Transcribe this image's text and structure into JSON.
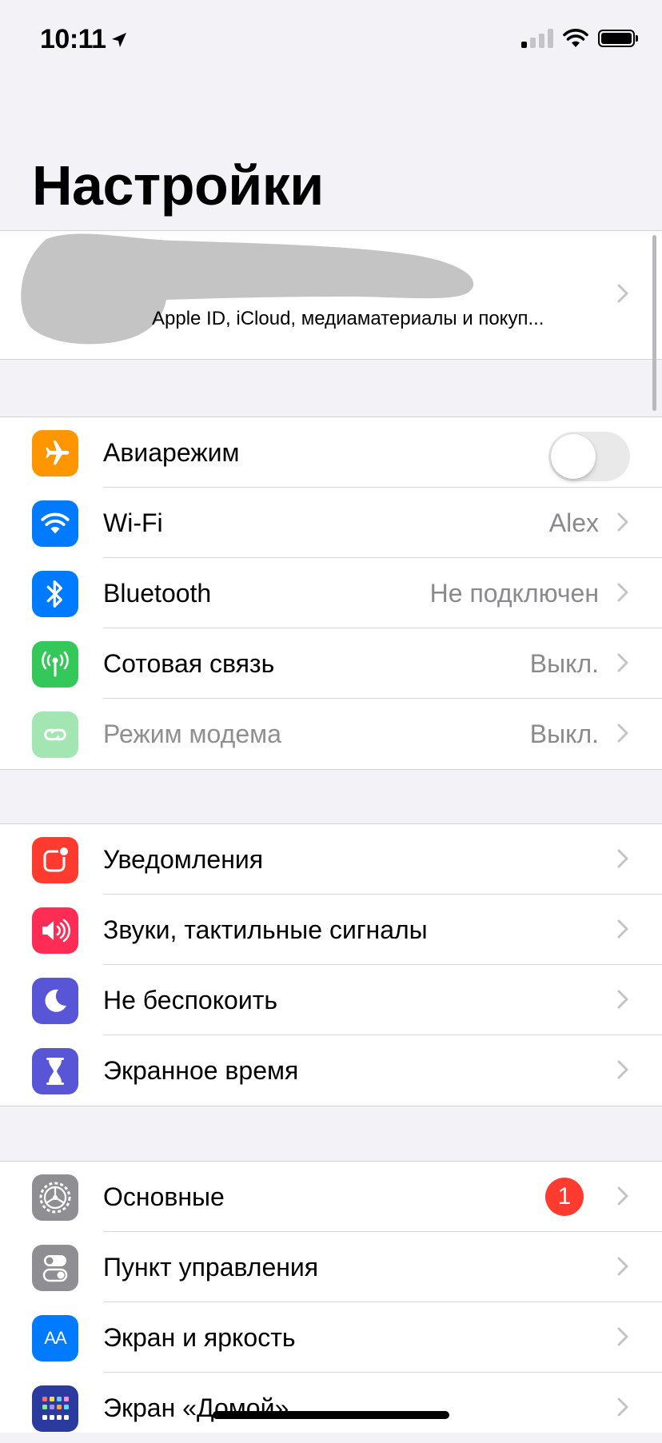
{
  "status_bar": {
    "time": "10:11"
  },
  "header": {
    "title": "Настройки"
  },
  "account": {
    "subtitle": "Apple ID, iCloud, медиаматериалы и покуп..."
  },
  "colors": {
    "orange": "#ff9500",
    "blue": "#007aff",
    "green": "#34c759",
    "red": "#ff3b30",
    "pink": "#ff2d55",
    "indigo": "#5856d6",
    "gray": "#8e8e93"
  },
  "group1": [
    {
      "label": "Авиарежим",
      "icon": "airplane-icon",
      "toggle": false
    },
    {
      "label": "Wi-Fi",
      "icon": "wifi-icon",
      "value": "Alex"
    },
    {
      "label": "Bluetooth",
      "icon": "bluetooth-icon",
      "value": "Не подключен"
    },
    {
      "label": "Сотовая связь",
      "icon": "cellular-antenna-icon",
      "value": "Выкл."
    },
    {
      "label": "Режим модема",
      "icon": "hotspot-link-icon",
      "value": "Выкл.",
      "disabled": true
    }
  ],
  "group2": [
    {
      "label": "Уведомления",
      "icon": "notifications-icon"
    },
    {
      "label": "Звуки, тактильные сигналы",
      "icon": "speaker-icon"
    },
    {
      "label": "Не беспокоить",
      "icon": "moon-icon"
    },
    {
      "label": "Экранное время",
      "icon": "hourglass-icon"
    }
  ],
  "group3": [
    {
      "label": "Основные",
      "icon": "gear-icon",
      "badge": "1"
    },
    {
      "label": "Пункт управления",
      "icon": "switches-icon"
    },
    {
      "label": "Экран и яркость",
      "icon": "text-size-icon",
      "icon_text": "AA"
    },
    {
      "label": "Экран «Домой»",
      "icon": "home-screen-grid-icon"
    }
  ]
}
